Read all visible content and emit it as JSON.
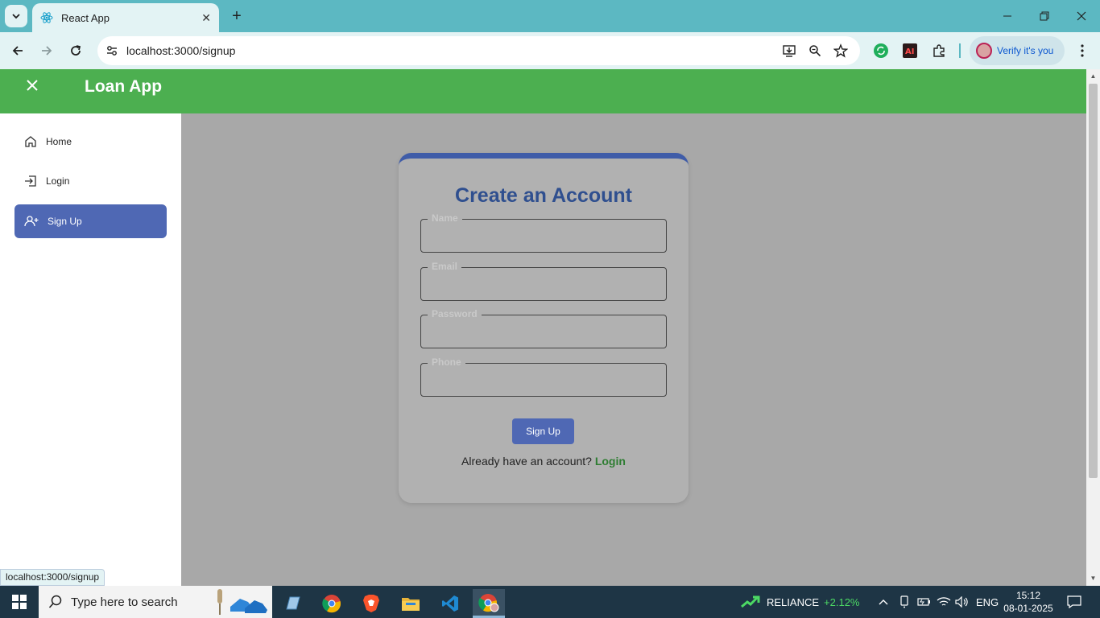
{
  "browser": {
    "tab_title": "React App",
    "url": "localhost:3000/signup",
    "profile_label": "Verify it's you",
    "status_url": "localhost:3000/signup"
  },
  "app": {
    "brand": "Loan App",
    "nav": [
      {
        "label": "Home",
        "icon": "home-icon"
      },
      {
        "label": "Login",
        "icon": "login-icon"
      },
      {
        "label": "Sign Up",
        "icon": "add-user-icon",
        "active": true
      }
    ]
  },
  "form": {
    "title": "Create an Account",
    "fields": [
      {
        "label": "Name",
        "value": ""
      },
      {
        "label": "Email",
        "value": ""
      },
      {
        "label": "Password",
        "value": ""
      },
      {
        "label": "Phone",
        "value": ""
      }
    ],
    "submit_label": "Sign Up",
    "already_text": "Already have an account?",
    "login_link": "Login"
  },
  "taskbar": {
    "search_placeholder": "Type here to search",
    "stock_name": "RELIANCE",
    "stock_change": "+2.12%",
    "language": "ENG",
    "time": "15:12",
    "date": "08-01-2025"
  },
  "colors": {
    "appbar": "#4caf50",
    "primary": "#4f68b4",
    "title": "#2f4f8f",
    "login_link": "#2e7d32",
    "stock_up": "#4cd964"
  }
}
